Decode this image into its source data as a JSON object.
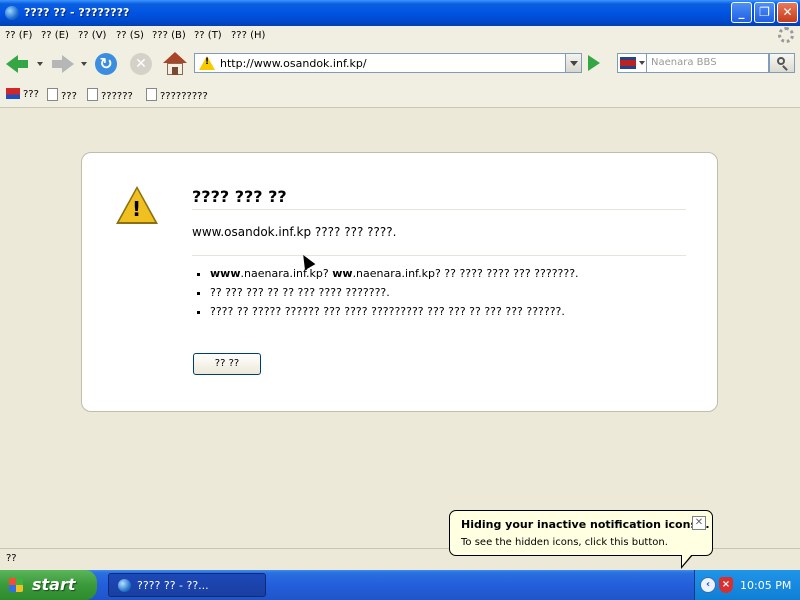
{
  "window": {
    "title": "???? ?? - ????????",
    "buttons": {
      "minimize": "_",
      "maximize": "❐",
      "close": "✕"
    }
  },
  "menu": {
    "items": [
      {
        "label": "?? (F)"
      },
      {
        "label": "?? (E)"
      },
      {
        "label": "?? (V)"
      },
      {
        "label": "?? (S)"
      },
      {
        "label": "??? (B)"
      },
      {
        "label": "?? (T)"
      },
      {
        "label": "??? (H)"
      }
    ]
  },
  "navigation": {
    "url": "http://www.osandok.inf.kp/",
    "search_placeholder": "Naenara BBS",
    "icons": {
      "back": "back-arrow-icon",
      "forward": "forward-arrow-icon",
      "reload": "reload-icon",
      "stop": "stop-icon",
      "home": "home-icon",
      "go": "go-arrow-icon",
      "search": "magnifier-icon"
    }
  },
  "bookmarks": [
    {
      "label": "???",
      "icon": "naenara-logo-icon"
    },
    {
      "label": "???",
      "icon": "document-icon"
    },
    {
      "label": "??????",
      "icon": "document-icon"
    },
    {
      "label": "?????????",
      "icon": "document-icon"
    }
  ],
  "error_page": {
    "heading": "???? ??? ??",
    "subtext": "www.osandok.inf.kp ???? ??? ????.",
    "bullets": [
      {
        "bold": "www",
        "text": ".naenara.inf.kp? ",
        "bold2": "ww",
        "text2": ".naenara.inf.kp? ?? ???? ???? ??? ???????."
      },
      {
        "text": "?? ??? ??? ?? ?? ??? ???? ???????."
      },
      {
        "text": "???? ?? ????? ?????? ??? ???? ????????? ??? ??? ?? ??? ??? ??????."
      }
    ],
    "button_label": "?? ??"
  },
  "status": {
    "text": "??"
  },
  "taskbar": {
    "start_label": "start",
    "task_label": "???? ?? - ??...",
    "clock": "10:05 PM"
  },
  "balloon": {
    "title": "Hiding your inactive notification icons...",
    "text": "To see the hidden icons, click this button.",
    "close": "✕"
  },
  "colors": {
    "titlebar": "#0054e3",
    "taskbar": "#245edb",
    "start_button": "#3a9a3a",
    "warning": "#f0c020",
    "page_bg": "#ece9d8"
  }
}
